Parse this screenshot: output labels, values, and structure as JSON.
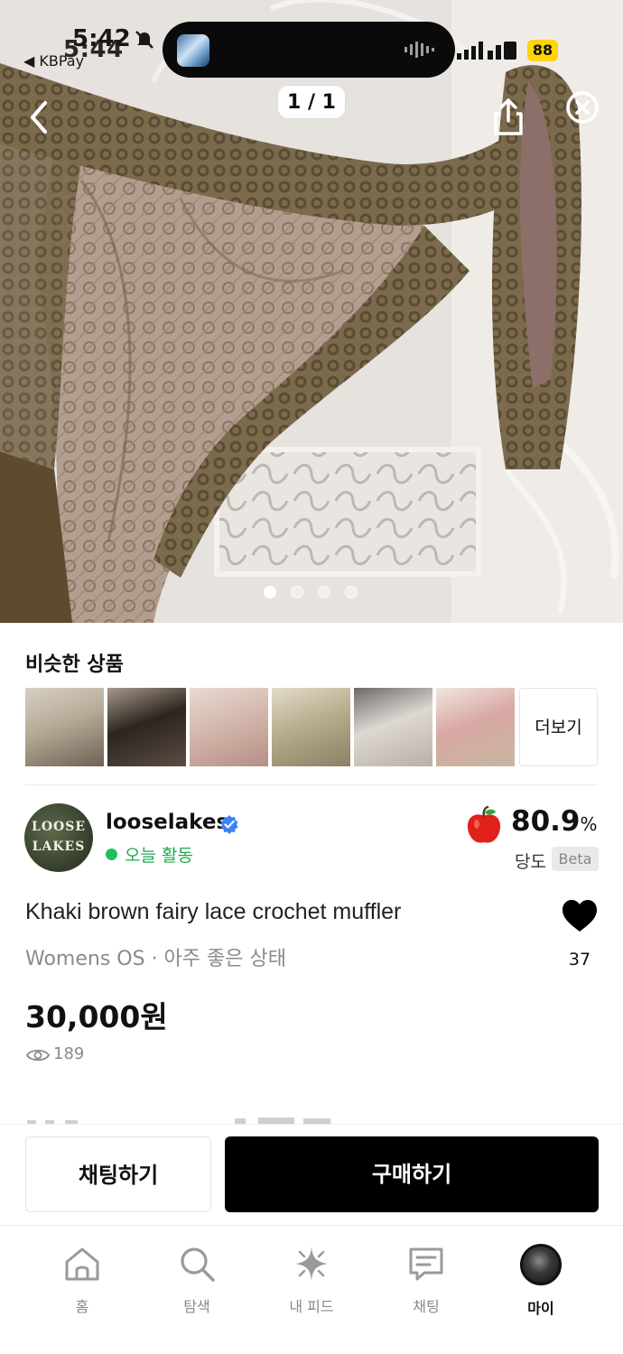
{
  "status_bar": {
    "time": "5:42",
    "time_behind": "5:44",
    "back_app": "◀ KBPay",
    "battery": "88"
  },
  "hero": {
    "image_counter": "1 / 1",
    "page_dots": 4,
    "active_dot": 0
  },
  "similar": {
    "title": "비슷한 상품",
    "more_label": "더보기",
    "items": [
      {
        "colors": [
          "#b7aa98",
          "#6f6254",
          "#d8d0c4"
        ]
      },
      {
        "colors": [
          "#2c2520",
          "#5a4c42",
          "#a89a8c"
        ]
      },
      {
        "colors": [
          "#d4b8ad",
          "#b48f84",
          "#e7dad2"
        ]
      },
      {
        "colors": [
          "#b8ad8d",
          "#8a8064",
          "#e3dccb"
        ]
      },
      {
        "colors": [
          "#ded8d2",
          "#b9b0a6",
          "#6d6a6a"
        ]
      },
      {
        "colors": [
          "#d8a8a4",
          "#c7b79e",
          "#efe6de"
        ]
      }
    ]
  },
  "seller": {
    "avatar_line1": "LOOSE",
    "avatar_line2": "LAKES",
    "name": "looselakes",
    "activity": "오늘 활동",
    "score": "80.9",
    "score_unit": "%",
    "score_label": "당도",
    "beta": "Beta"
  },
  "product": {
    "title": "Khaki brown fairy lace crochet muffler",
    "meta": "Womens OS · 아주 좋은 상태",
    "likes": "37",
    "price": "30,000원",
    "views": "189"
  },
  "actions": {
    "chat": "채팅하기",
    "buy": "구매하기"
  },
  "tabs": [
    {
      "label": "홈",
      "icon": "home-icon"
    },
    {
      "label": "탐색",
      "icon": "search-icon"
    },
    {
      "label": "내 피드",
      "icon": "sparkle-icon"
    },
    {
      "label": "채팅",
      "icon": "chat-icon"
    },
    {
      "label": "마이",
      "icon": "avatar"
    }
  ],
  "colors": {
    "accent_green": "#1fc05a",
    "verified_blue": "#3b82f6",
    "buy_button": "#000000",
    "battery": "#ffd400"
  }
}
